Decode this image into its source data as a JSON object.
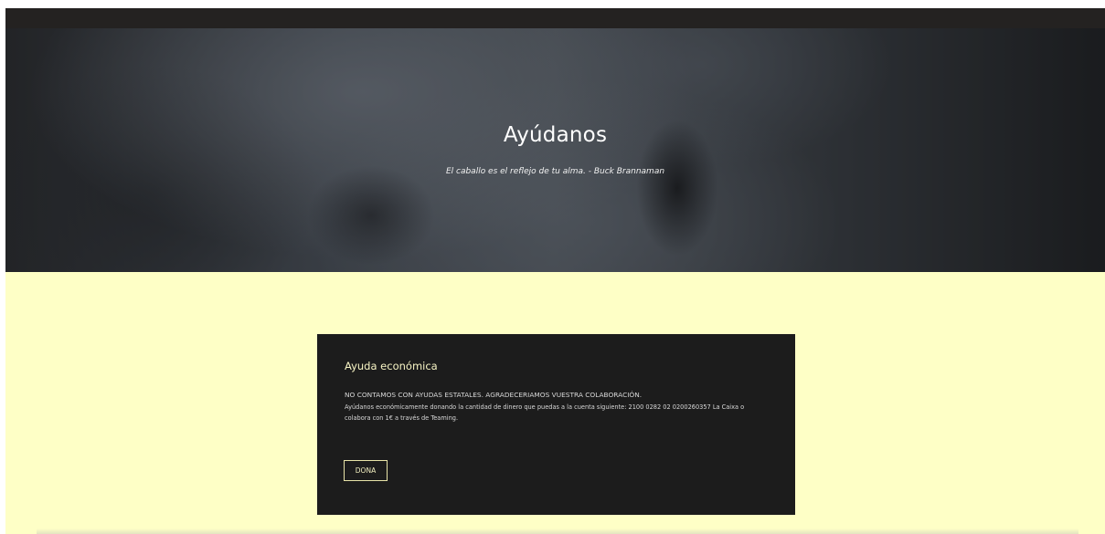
{
  "hero": {
    "title": "Ayúdanos",
    "quote": "El caballo es el reflejo de tu alma. - Buck Brannaman"
  },
  "donation_card": {
    "title": "Ayuda económica",
    "line1": "NO CONTAMOS CON AYUDAS ESTATALES. AGRADECERIAMOS VUESTRA COLABORACIÓN.",
    "line2": "Ayúdanos económicamente donando la cantidad de dinero que puedas a la cuenta siguiente: 2100 0282 02 0200260357 La Caixa o colabora con 1€ a través de Teaming.",
    "button_label": "DONA"
  },
  "colors": {
    "top_bar": "#242221",
    "section_background": "#feffc6",
    "card_background": "#1c1c1c",
    "accent": "#f7f4c4"
  }
}
